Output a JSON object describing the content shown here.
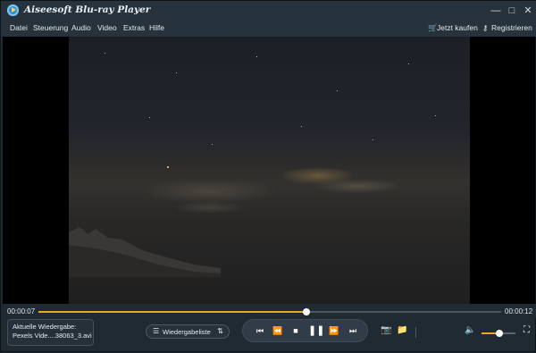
{
  "window": {
    "title": "Aiseesoft Blu-ray Player",
    "controls": [
      "minimize",
      "maximize",
      "close"
    ]
  },
  "menu": {
    "items": [
      "Datei",
      "Steuerung",
      "Audio",
      "Video",
      "Extras",
      "Hilfe"
    ],
    "buy_label": "Jetzt kaufen",
    "register_label": "Registrieren"
  },
  "player": {
    "current_time": "00:00:07",
    "total_time": "00:00:12",
    "progress_fraction": 0.58,
    "volume_fraction": 0.52,
    "now_playing_label": "Aktuelle Wiedergabe:",
    "now_playing_file": "Pexels Vide....38063_3.avi",
    "playlist_label": "Wiedergabeliste"
  },
  "colors": {
    "accent": "#f2a623",
    "background": "#1f2a33",
    "video_bg": "#000000"
  }
}
